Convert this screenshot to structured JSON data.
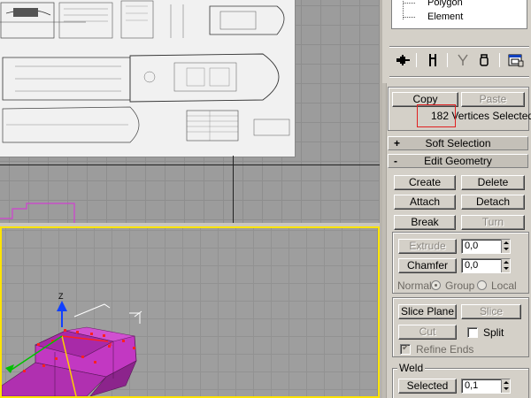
{
  "sub_object_tree": {
    "items": [
      "Polygon",
      "Element"
    ]
  },
  "toolbar": {
    "icons": [
      "pin-stack-icon",
      "show-end-result-icon",
      "make-unique-icon",
      "remove-modifier-icon",
      "configure-sets-icon"
    ]
  },
  "selection": {
    "copy_label": "Copy",
    "paste_label": "Paste",
    "status": "182 Vertices Selected"
  },
  "rollouts": {
    "soft_selection": {
      "sign": "+",
      "label": "Soft Selection"
    },
    "edit_geometry": {
      "sign": "-",
      "label": "Edit Geometry"
    }
  },
  "edit_geometry": {
    "create": "Create",
    "delete": "Delete",
    "attach": "Attach",
    "detach": "Detach",
    "break": "Break",
    "turn": "Turn",
    "extrude": "Extrude",
    "extrude_value": "0,0",
    "chamfer": "Chamfer",
    "chamfer_value": "0,0",
    "normal_label": "Normal:",
    "normal_group": "Group",
    "normal_local": "Local",
    "slice_plane": "Slice Plane",
    "slice": "Slice",
    "cut": "Cut",
    "split": "Split",
    "refine_ends": "Refine Ends",
    "weld_title": "Weld",
    "weld_selected": "Selected",
    "weld_value": "0,1"
  },
  "viewport": {
    "axis_z_label": "Z"
  },
  "colors": {
    "active_viewport_border": "#ffe400",
    "selection_highlight": "#e02020",
    "mesh_color": "#c040c0"
  }
}
